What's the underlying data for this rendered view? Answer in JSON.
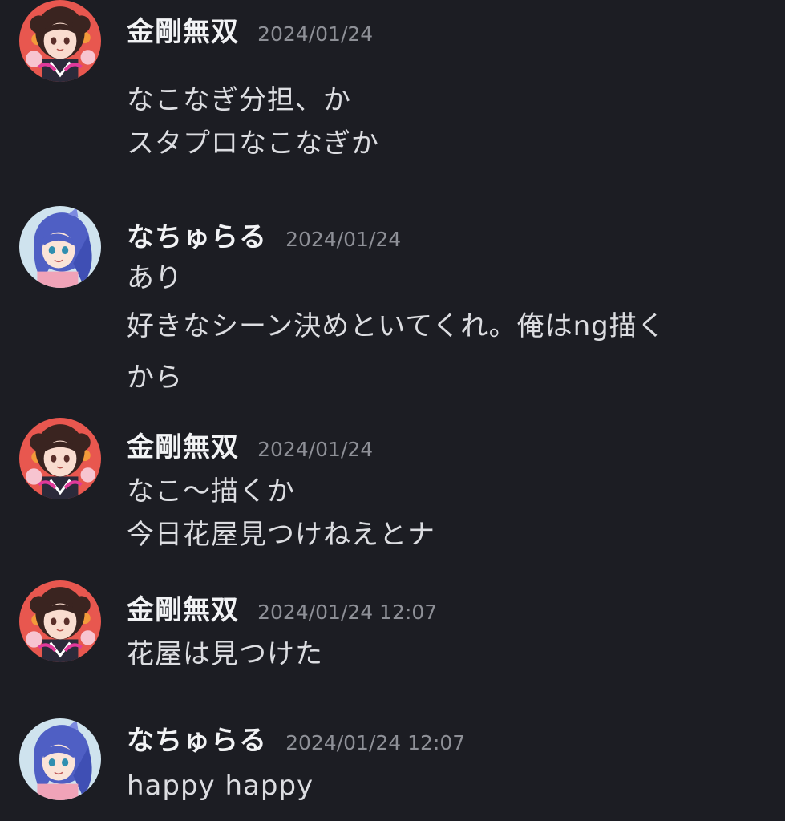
{
  "messages": [
    {
      "user": "金剛無双",
      "avatar": "kongo-avatar",
      "timestamp": "2024/01/24",
      "lines": [
        "なこなぎ分担、か",
        "スタプロなこなぎか"
      ]
    },
    {
      "user": "なちゅらる",
      "avatar": "nachuraru-avatar",
      "timestamp": "2024/01/24",
      "lines": [
        "あり",
        "好きなシーン決めといてくれ。俺はng描く",
        "から"
      ]
    },
    {
      "user": "金剛無双",
      "avatar": "kongo-avatar",
      "timestamp": "2024/01/24",
      "lines": [
        "なこ〜描くか",
        "今日花屋見つけねえとナ"
      ]
    },
    {
      "user": "金剛無双",
      "avatar": "kongo-avatar",
      "timestamp": "2024/01/24 12:07",
      "lines": [
        "花屋は見つけた"
      ]
    },
    {
      "user": "なちゅらる",
      "avatar": "nachuraru-avatar",
      "timestamp": "2024/01/24 12:07",
      "lines": [
        "happy happy"
      ]
    }
  ],
  "colors": {
    "background": "#1c1d23",
    "username": "#f2f3f5",
    "timestamp": "#8e9097",
    "text": "#dcdde1"
  }
}
